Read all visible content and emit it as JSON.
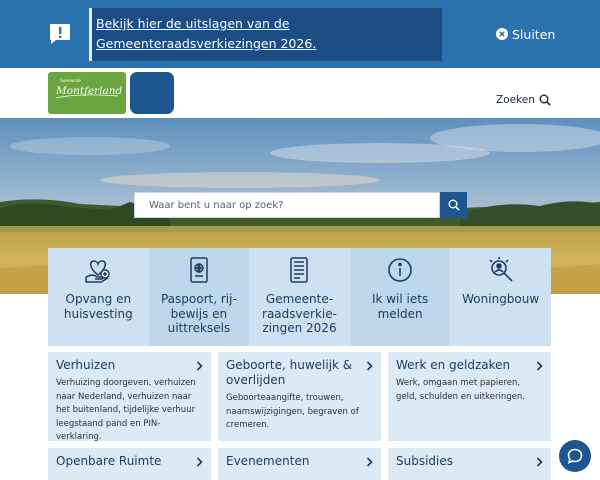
{
  "alert": {
    "icon": "exclamation-speech-icon",
    "text": "Bekijk hier de uitslagen van de Gemeenteraadsverkiezingen 2026.",
    "close_label": "Sluiten"
  },
  "header": {
    "logo_small_text": "Gemeente",
    "logo_text": "Montferland",
    "search_label": "Zoeken"
  },
  "hero": {
    "search_placeholder": "Waar bent u naar op zoek?"
  },
  "tiles": [
    {
      "label": "Opvang en\nhuisvesting",
      "icon": "heart-hand-icon"
    },
    {
      "label": "Paspoort, rij-\nbewijs en\nuittreksels",
      "icon": "passport-icon"
    },
    {
      "label": "Gemeente-\nraadsverkie-\nzingen 2026",
      "icon": "document-icon"
    },
    {
      "label": "Ik wil iets\nmelden",
      "icon": "info-icon"
    },
    {
      "label": "Woningbouw",
      "icon": "magnifier-icon"
    }
  ],
  "cards": [
    {
      "title": "Verhuizen",
      "desc": "Verhuizing doorgeven, verhuizen naar Nederland, verhuizen naar het buitenland, tijdelijke verhuur leegstaand pand en PIN-verklaring."
    },
    {
      "title": "Geboorte, huwelijk & overlijden",
      "desc": "Geboorteaangifte, trouwen, naamswijzigingen, begraven of cremeren."
    },
    {
      "title": "Werk en geldzaken",
      "desc": "Werk, omgaan met papieren, geld, schulden en uitkeringen."
    },
    {
      "title": "Openbare Ruimte",
      "desc": ""
    },
    {
      "title": "Evenementen",
      "desc": ""
    },
    {
      "title": "Subsidies",
      "desc": ""
    }
  ],
  "chat": {
    "icon": "chat-bubble-icon"
  },
  "colors": {
    "banner": "#2a72ad",
    "banner_box": "#1c4d82",
    "brand_green": "#6ba53f",
    "brand_blue": "#1d558f",
    "tile_light": "#cde1f0",
    "card_bg": "#dceaf6"
  }
}
